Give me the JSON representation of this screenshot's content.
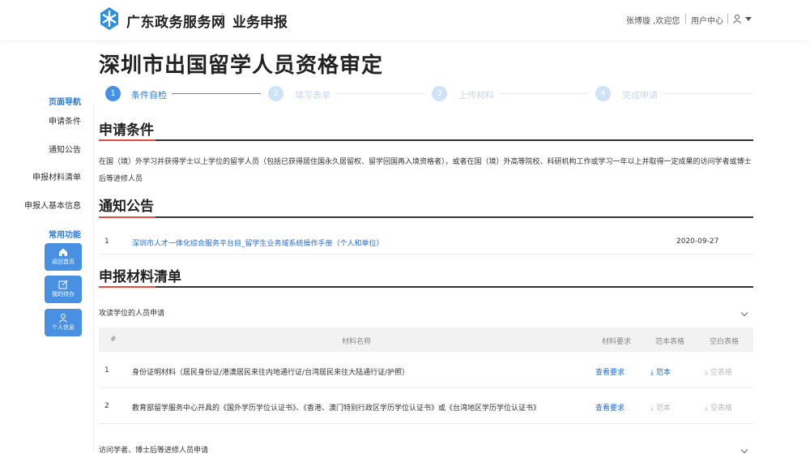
{
  "header": {
    "brand": "广东政务服务网",
    "sub_brand": "业务申报",
    "welcome": "张博璇 ,欢迎您",
    "user_center": "用户中心"
  },
  "page_title": "深圳市出国留学人员资格审定",
  "steps": [
    {
      "num": "1",
      "label": "条件自检",
      "active": true
    },
    {
      "num": "2",
      "label": "填写表单",
      "active": false
    },
    {
      "num": "3",
      "label": "上传材料",
      "active": false
    },
    {
      "num": "4",
      "label": "完成申请",
      "active": false
    }
  ],
  "sidebar": {
    "nav_head": "页面导航",
    "items": [
      "申请条件",
      "通知公告",
      "申报材料清单",
      "申报人基本信息"
    ],
    "func_head": "常用功能",
    "buttons": [
      "返回首页",
      "我的待办",
      "个人信息"
    ]
  },
  "conditions": {
    "title": "申请条件",
    "text": "在国（境）外学习并获得学士以上学位的留学人员（包括已获得居住国永久居留权、留学回国再入境资格者），或者在国（境）外高等院校、科研机构工作或学习一年以上并取得一定成果的访问学者或博士后等进修人员"
  },
  "notices": {
    "title": "通知公告",
    "items": [
      {
        "num": "1",
        "title": "深圳市人才一体化综合服务平台目_留学生业务域系统操作手册（个人和单位）",
        "date": "2020-09-27"
      }
    ]
  },
  "materials": {
    "title": "申报材料清单",
    "group1": "攻读学位的人员申请",
    "group2": "访问学者、博士后等进修人员申请",
    "columns": {
      "num": "#",
      "name": "材料名称",
      "req": "材料要求",
      "sample": "范本表格",
      "blank": "空白表格"
    },
    "rows": [
      {
        "num": "1",
        "name": "身份证明材料（居民身份证/港澳居民来往内地通行证/台湾居民来往大陆通行证/护照）",
        "req": "查看要求",
        "sample": "范本",
        "blank": "空表格"
      },
      {
        "num": "2",
        "name": "教育部留学服务中心开具的《国外学历学位认证书》、《香港、澳门特别行政区学历学位认证书》或《台湾地区学历学位认证书》",
        "req": "查看要求",
        "sample": "范本",
        "blank": "空表格"
      }
    ]
  }
}
